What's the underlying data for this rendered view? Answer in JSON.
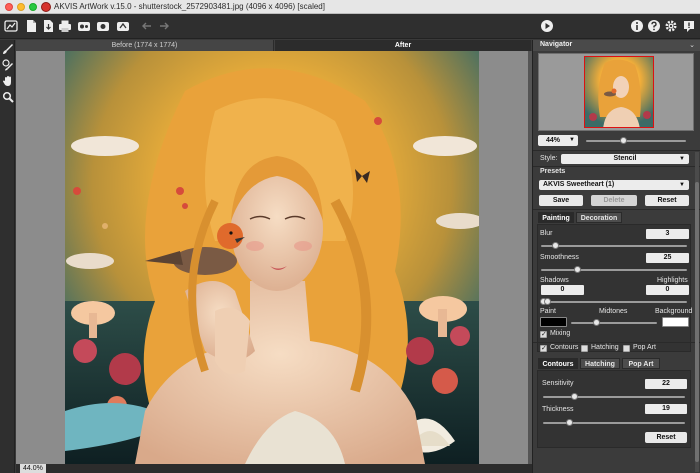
{
  "window": {
    "title": "AKVIS ArtWork v.15.0 - shutterstock_2572903481.jpg (4096 x 4096) [scaled]"
  },
  "toolbar": {
    "icons": [
      "home-icon",
      "open-file-icon",
      "save-icon",
      "print-icon",
      "batch-icon",
      "share-icon",
      "settings-icon",
      "undo-icon",
      "redo-icon",
      "run-icon",
      "info-icon",
      "help-icon",
      "preferences-icon",
      "notifications-icon"
    ]
  },
  "tools": [
    "brush-icon",
    "eraser-brush-icon",
    "hand-icon",
    "zoom-icon"
  ],
  "view_tabs": {
    "before": "Before (1774 x 1774)",
    "after": "After",
    "active": "After"
  },
  "status": {
    "zoom": "44.0%"
  },
  "navigator": {
    "title": "Navigator",
    "zoom_value": "44%",
    "zoom_slider_fraction": 0.37
  },
  "settings": {
    "style_label": "Style:",
    "style_value": "Stencil",
    "presets_label": "Presets",
    "preset_value": "AKVIS Sweetheart (1)",
    "buttons": {
      "save": "Save",
      "delete": "Delete",
      "reset": "Reset"
    },
    "tabs": {
      "painting": "Painting",
      "decoration": "Decoration",
      "active": "Painting"
    },
    "blur": {
      "label": "Blur",
      "value": "3",
      "fraction": 0.1
    },
    "smoothness": {
      "label": "Smoothness",
      "value": "25",
      "fraction": 0.25
    },
    "shadows": {
      "label": "Shadows",
      "value": "0"
    },
    "highlights": {
      "label": "Highlights",
      "value": "0"
    },
    "paint_label": "Paint",
    "midtones_label": "Midtones",
    "background_label": "Background",
    "paint_color": "#000000",
    "background_color": "#ffffff",
    "mixing": {
      "label": "Mixing",
      "checked": true
    },
    "effects": [
      {
        "label": "Contours",
        "checked": true
      },
      {
        "label": "Hatching",
        "checked": false
      },
      {
        "label": "Pop Art",
        "checked": false
      }
    ],
    "effect_tabs": {
      "contours": "Contours",
      "hatching": "Hatching",
      "pop_art": "Pop Art",
      "active": "Contours"
    },
    "sensitivity": {
      "label": "Sensitivity",
      "value": "22",
      "fraction": 0.22
    },
    "thickness": {
      "label": "Thickness",
      "value": "19",
      "fraction": 0.19
    },
    "reset_button": "Reset"
  }
}
